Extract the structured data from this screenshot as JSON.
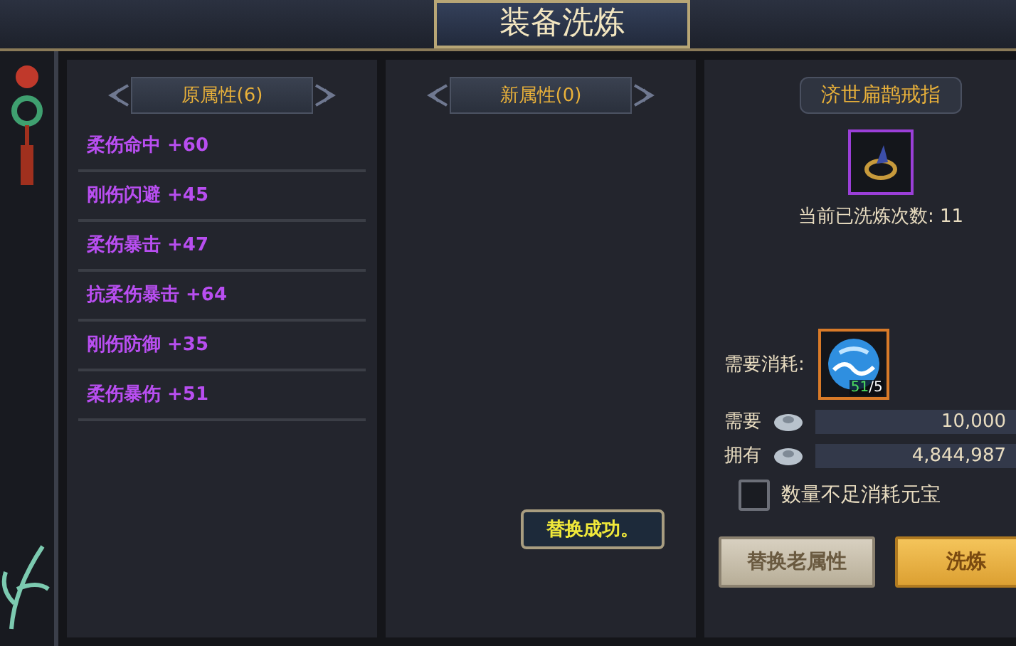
{
  "window": {
    "title": "装备洗炼"
  },
  "old_attributes": {
    "title": "原属性(6)",
    "items": [
      {
        "text": "柔伤命中 +60"
      },
      {
        "text": "刚伤闪避 +45"
      },
      {
        "text": "柔伤暴击 +47"
      },
      {
        "text": "抗柔伤暴击 +64"
      },
      {
        "text": "刚伤防御 +35"
      },
      {
        "text": "柔伤暴伤 +51"
      }
    ]
  },
  "new_attributes": {
    "title": "新属性(0)"
  },
  "toast": "替换成功。",
  "equipment": {
    "name": "济世扁鹊戒指",
    "refine_count_label": "当前已洗炼次数: 11"
  },
  "cost": {
    "label": "需要消耗:",
    "item_owned": "51",
    "item_needed": "/5",
    "rows": [
      {
        "label": "需要",
        "value": "10,000"
      },
      {
        "label": "拥有",
        "value": "4,844,987"
      }
    ],
    "use_gold": {
      "label": "数量不足消耗元宝",
      "checked": false
    }
  },
  "buttons": [
    {
      "label": "替换老属性",
      "kind": "secondary"
    },
    {
      "label": "洗炼",
      "kind": "primary"
    }
  ]
}
